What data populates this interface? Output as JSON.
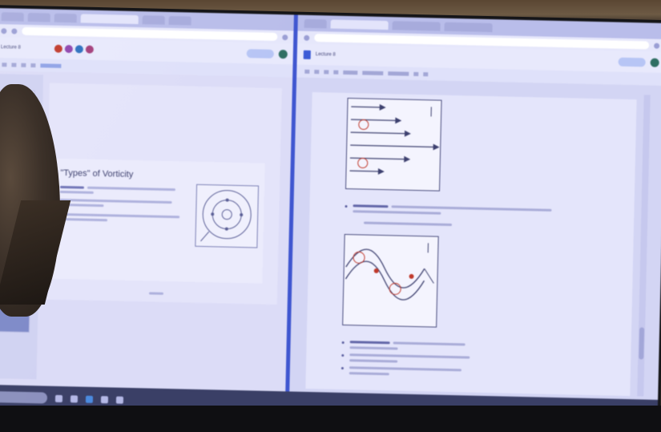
{
  "left_window": {
    "doc_title": "Lecture 8",
    "slide": {
      "title": "\"Types\" of Vorticity"
    }
  },
  "right_window": {
    "doc_title": "Lecture 8"
  },
  "colors": {
    "screen_tint": "#c8cbf2",
    "divider": "#3f56d0",
    "taskbar": "#3a3f66"
  },
  "icons": [
    "search-icon",
    "windows-icon",
    "share-icon",
    "avatar-icon"
  ]
}
